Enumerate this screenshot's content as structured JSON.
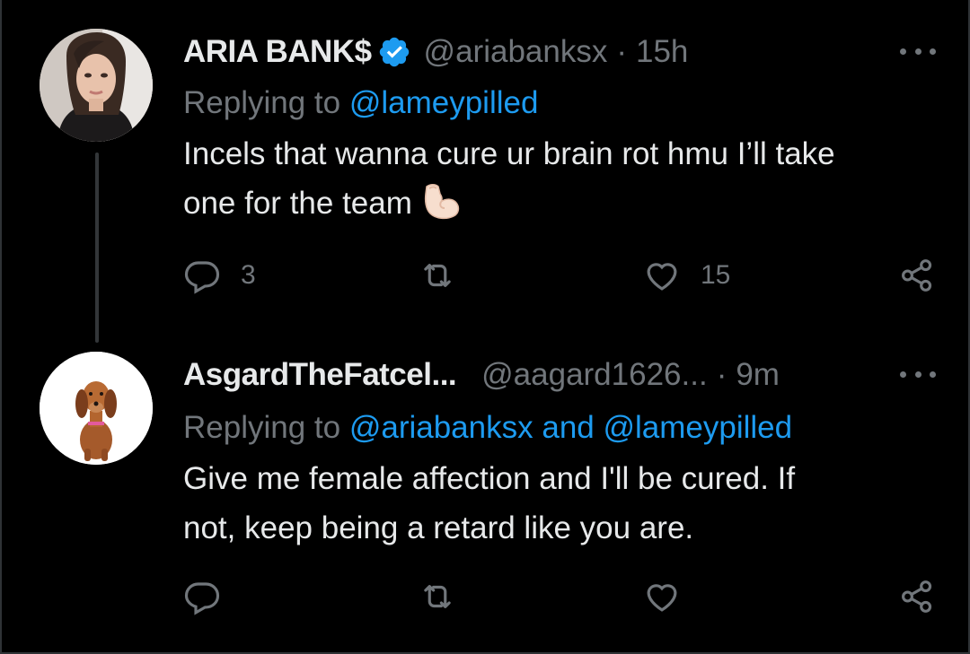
{
  "tweets": [
    {
      "display_name": "ARIA BANK$",
      "verified": true,
      "handle": "@ariabanksx",
      "separator": "·",
      "time": "15h",
      "reply_prefix": "Replying to ",
      "reply_mentions": [
        "@lameypilled"
      ],
      "reply_joiner": "",
      "body_lines": [
        "Incels that wanna cure ur brain rot hmu I’ll take",
        "one for the team"
      ],
      "emoji": "flexed-biceps-icon",
      "counts": {
        "replies": "3",
        "retweets": "",
        "likes": "15"
      }
    },
    {
      "display_name": "AsgardTheFatcel...",
      "verified": false,
      "handle": "@aagard1626...",
      "separator": "·",
      "time": "9m",
      "reply_prefix": "Replying to ",
      "reply_mentions": [
        "@ariabanksx",
        "@lameypilled"
      ],
      "reply_joiner": " and ",
      "body_lines": [
        "Give me female affection and I'll be cured. If",
        "not, keep being a retard like you are."
      ],
      "counts": {
        "replies": "",
        "retweets": "",
        "likes": ""
      }
    }
  ],
  "colors": {
    "background": "#000000",
    "text": "#e7e9ea",
    "secondary": "#71767b",
    "link": "#1d9bf0",
    "verified": "#1d9bf0",
    "thread_line": "#333639"
  }
}
